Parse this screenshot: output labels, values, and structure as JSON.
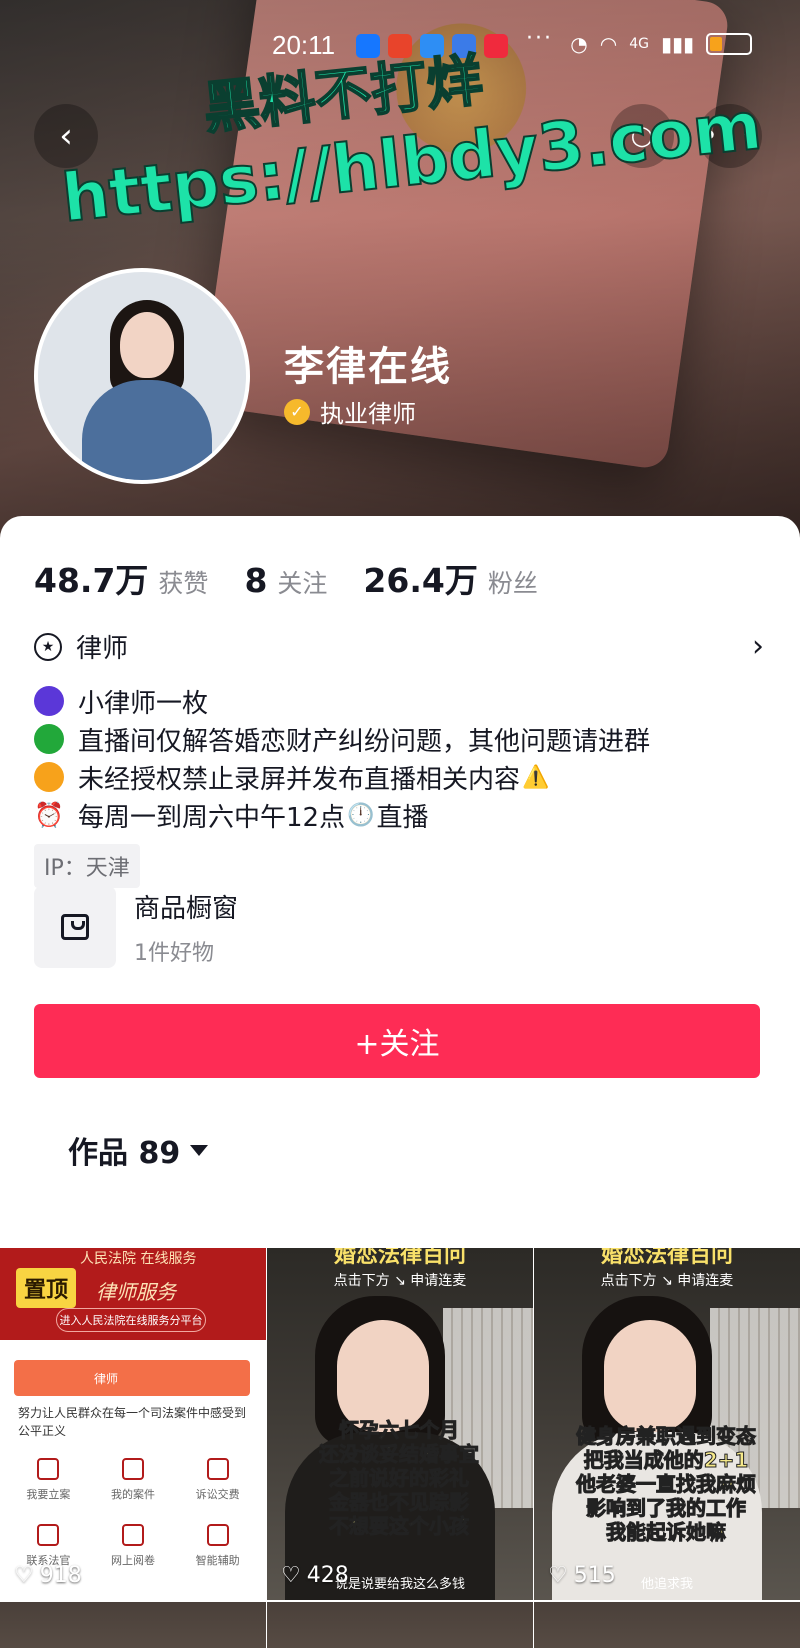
{
  "status_bar": {
    "time": "20:11",
    "dots": "···",
    "network": "4G",
    "notifications": [
      "shield",
      "mail",
      "chat",
      "browser",
      "app"
    ]
  },
  "watermark": {
    "line1": "黑料不打烊",
    "line2": "https://hlbdy3.com"
  },
  "profile": {
    "name": "李律在线",
    "verification": "执业律师",
    "verification_color": "#f6b92c"
  },
  "stats": [
    {
      "value": "48.7万",
      "label": "获赞"
    },
    {
      "value": "8",
      "label": "关注"
    },
    {
      "value": "26.4万",
      "label": "粉丝"
    }
  ],
  "role": {
    "label": "律师"
  },
  "bio": [
    {
      "marker": "purple-dot",
      "color": "#5b37d8",
      "text": "小律师一枚"
    },
    {
      "marker": "green-dot",
      "color": "#22a83a",
      "text": "直播间仅解答婚恋财产纠纷问题，其他问题请进群"
    },
    {
      "marker": "orange-dot",
      "color": "#f7a21b",
      "text": "未经授权禁止录屏并发布直播相关内容",
      "suffix": "⚠️"
    },
    {
      "marker": "alarm-clock",
      "emoji": "⏰",
      "text": "每周一到周六中午12点",
      "mid_emoji": "🕛",
      "tail": "直播"
    }
  ],
  "ip": "IP：天津",
  "shop": {
    "title": "商品橱窗",
    "subtitle": "1件好物"
  },
  "follow_button": "+关注",
  "works_tab": {
    "label": "作品 89"
  },
  "videos": [
    {
      "pinned": "置顶",
      "header": "人民法院  在线服务",
      "service": "律师服务",
      "entry": "进入人民法院在线服务分平台",
      "card_role": "律师",
      "note": "努力让人民群众在每一个司法案件中感受到公平正义",
      "menu": [
        "我要立案",
        "我的案件",
        "诉讼交费",
        "联系法官",
        "网上阅卷",
        "智能辅助"
      ],
      "likes": "918"
    },
    {
      "banner": "婚恋法律百问",
      "subbanner": "点击下方 ↘ 申请连麦",
      "caption_lines": [
        "怀孕六七个月",
        "还没谈妥结婚事宜",
        "之前说好的彩礼",
        "金器也不见踪影",
        "不想要这个小孩"
      ],
      "caption_small": "说是说要给我这么多钱",
      "likes": "428"
    },
    {
      "banner": "婚恋法律百问",
      "subbanner": "点击下方 ↘ 申请连麦",
      "caption_lines": [
        "健身房兼职遇到变态",
        "把我当成他的2+1",
        "他老婆一直找我麻烦",
        "影响到了我的工作",
        "我能起诉她嘛"
      ],
      "caption_small": "他追求我",
      "likes": "515"
    }
  ]
}
